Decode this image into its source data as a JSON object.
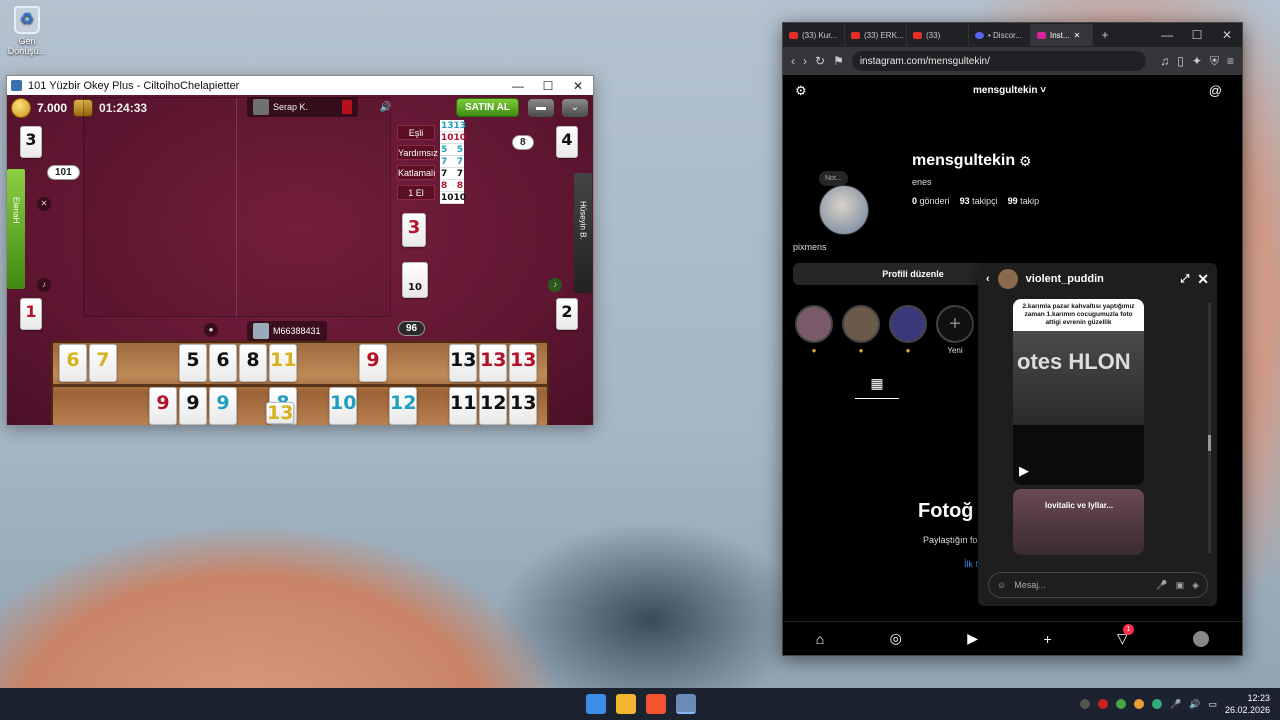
{
  "desktop": {
    "recycle_label": "Geri Dönüşü..."
  },
  "game_window": {
    "title": "101 Yüzbir Okey Plus - CiltoihoChelapietter",
    "coins": "7.000",
    "timer": "01:24:33",
    "buy_label": "SATIN AL",
    "top_player": "Serap K.",
    "bottom_player": "M66388431",
    "left_player": "ElenaH",
    "right_player": "Hüseyin B.",
    "counters": {
      "top_left": "3",
      "top_right": "4",
      "bottom_left": "1",
      "bottom_right": "2",
      "left_score": "101",
      "right_badge": "8",
      "remaining": "96"
    },
    "options": [
      "Eşli",
      "Yardımsız",
      "Katlamalı",
      "1 El"
    ],
    "indicator_tile": "3",
    "deck_tile": "10",
    "score_rows": [
      {
        "a": "13",
        "b": "13",
        "ca": "#1f9fbf",
        "cb": "#1f9fbf"
      },
      {
        "a": "10",
        "b": "10",
        "ca": "#b3122a",
        "cb": "#b3122a"
      },
      {
        "a": "5",
        "b": "5",
        "ca": "#1f9fbf",
        "cb": "#1f9fbf"
      },
      {
        "a": "7",
        "b": "7",
        "ca": "#1f9fbf",
        "cb": "#1f9fbf"
      },
      {
        "a": "7",
        "b": "7",
        "ca": "#111111",
        "cb": "#111111"
      },
      {
        "a": "8",
        "b": "8",
        "ca": "#b3122a",
        "cb": "#b3122a"
      },
      {
        "a": "10",
        "b": "10",
        "ca": "#111111",
        "cb": "#111111"
      }
    ],
    "rack_top": [
      {
        "v": "6",
        "c": "c-yellow"
      },
      {
        "v": "7",
        "c": "c-yellow"
      },
      {
        "v": "5",
        "c": "c-black"
      },
      {
        "v": "6",
        "c": "c-black"
      },
      {
        "v": "8",
        "c": "c-black"
      },
      {
        "v": "11",
        "c": "c-yellow"
      },
      {
        "v": "9",
        "c": "c-red"
      },
      {
        "v": "13",
        "c": "c-black"
      },
      {
        "v": "13",
        "c": "c-red"
      },
      {
        "v": "13",
        "c": "c-red"
      }
    ],
    "rack_bottom": [
      {
        "v": "9",
        "c": "c-red"
      },
      {
        "v": "9",
        "c": "c-black"
      },
      {
        "v": "9",
        "c": "c-teal"
      },
      {
        "v": "8",
        "c": "c-teal"
      },
      {
        "v": "10",
        "c": "c-teal"
      },
      {
        "v": "12",
        "c": "c-teal"
      },
      {
        "v": "11",
        "c": "c-black"
      },
      {
        "v": "12",
        "c": "c-black"
      },
      {
        "v": "13",
        "c": "c-black"
      }
    ],
    "floating_tile": "13"
  },
  "browser": {
    "tabs": [
      "(33) Kur...",
      "(33) ERK...",
      "(33)",
      "• Discor...",
      "Inst..."
    ],
    "url": "instagram.com/mensgultekin/"
  },
  "instagram": {
    "header_username": "mensgultekin ˅",
    "note": "Not...",
    "username": "mensgultekin",
    "full_name": "enes",
    "posts": "0",
    "posts_label": "gönderi",
    "followers": "93",
    "followers_label": "takipçi",
    "following": "99",
    "following_label": "takip",
    "bio": "pixmens",
    "edit_button": "Profili düzenle",
    "new_highlight": "Yeni",
    "empty_title": "Fotoğ",
    "empty_sub": "Paylaştığın fo",
    "empty_link": "İlk t",
    "notif_count": "1"
  },
  "dm": {
    "name": "violent_puddin",
    "post_caption": "2.karımla pazar kahvaltısı yaptığımız zaman 1.karımın cocugumuzla foto attigi evrenin güzellik",
    "post_img_text": "otes HLON",
    "reel_title": "lovitalic ve lyllar...",
    "input_placeholder": "Mesaj..."
  },
  "taskbar": {
    "time": "12:23",
    "date": "26.02.2026"
  }
}
